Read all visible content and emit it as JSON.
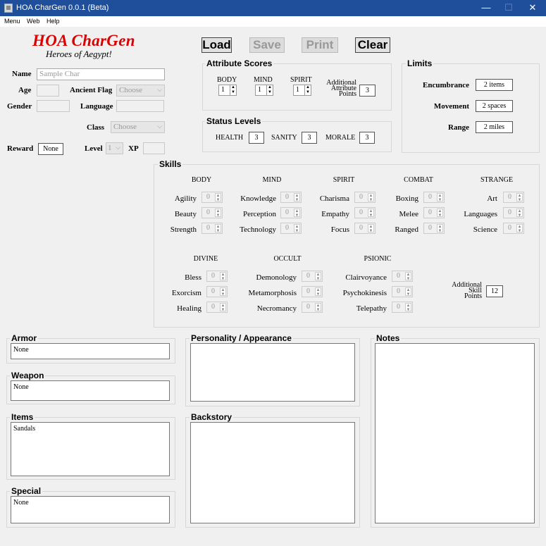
{
  "window": {
    "title": "HOA CharGen 0.0.1 (Beta)",
    "min": "—",
    "max": "☐",
    "close": "✕"
  },
  "menu": [
    "Menu",
    "Web",
    "Help"
  ],
  "logo": {
    "title": "HOA CharGen",
    "subtitle": "Heroes of Aegypt!"
  },
  "toolbar": {
    "load": "Load",
    "save": "Save",
    "print": "Print",
    "clear": "Clear"
  },
  "identity": {
    "name_label": "Name",
    "name_placeholder": "Sample Char",
    "age_label": "Age",
    "ancient_label": "Ancient Flag",
    "ancient_value": "Choose",
    "gender_label": "Gender",
    "language_label": "Language",
    "class_label": "Class",
    "class_value": "Choose",
    "reward_label": "Reward",
    "reward_value": "None",
    "level_label": "Level",
    "level_value": "1",
    "xp_label": "XP"
  },
  "attributes": {
    "title": "Attribute Scores",
    "body_label": "BODY",
    "body_value": "1",
    "mind_label": "MIND",
    "mind_value": "1",
    "spirit_label": "SPIRIT",
    "spirit_value": "1",
    "additional_l1": "Additional",
    "additional_l2": "Attribute",
    "additional_l3": "Points",
    "additional_value": "3"
  },
  "status": {
    "title": "Status Levels",
    "health_label": "HEALTH",
    "health_value": "3",
    "sanity_label": "SANITY",
    "sanity_value": "3",
    "morale_label": "MORALE",
    "morale_value": "3"
  },
  "limits": {
    "title": "Limits",
    "enc_label": "Encumbrance",
    "enc_value": "2 items",
    "mov_label": "Movement",
    "mov_value": "2 spaces",
    "range_label": "Range",
    "range_value": "2 miles"
  },
  "skills": {
    "title": "Skills",
    "body": {
      "title": "BODY",
      "items": [
        {
          "name": "Agility",
          "value": "0"
        },
        {
          "name": "Beauty",
          "value": "0"
        },
        {
          "name": "Strength",
          "value": "0"
        }
      ]
    },
    "mind": {
      "title": "MIND",
      "items": [
        {
          "name": "Knowledge",
          "value": "0"
        },
        {
          "name": "Perception",
          "value": "0"
        },
        {
          "name": "Technology",
          "value": "0"
        }
      ]
    },
    "spirit": {
      "title": "SPIRIT",
      "items": [
        {
          "name": "Charisma",
          "value": "0"
        },
        {
          "name": "Empathy",
          "value": "0"
        },
        {
          "name": "Focus",
          "value": "0"
        }
      ]
    },
    "combat": {
      "title": "COMBAT",
      "items": [
        {
          "name": "Boxing",
          "value": "0"
        },
        {
          "name": "Melee",
          "value": "0"
        },
        {
          "name": "Ranged",
          "value": "0"
        }
      ]
    },
    "strange": {
      "title": "STRANGE",
      "items": [
        {
          "name": "Art",
          "value": "0"
        },
        {
          "name": "Languages",
          "value": "0"
        },
        {
          "name": "Science",
          "value": "0"
        }
      ]
    },
    "divine": {
      "title": "DIVINE",
      "items": [
        {
          "name": "Bless",
          "value": "0"
        },
        {
          "name": "Exorcism",
          "value": "0"
        },
        {
          "name": "Healing",
          "value": "0"
        }
      ]
    },
    "occult": {
      "title": "OCCULT",
      "items": [
        {
          "name": "Demonology",
          "value": "0"
        },
        {
          "name": "Metamorphosis",
          "value": "0"
        },
        {
          "name": "Necromancy",
          "value": "0"
        }
      ]
    },
    "psionic": {
      "title": "PSIONIC",
      "items": [
        {
          "name": "Clairvoyance",
          "value": "0"
        },
        {
          "name": "Psychokinesis",
          "value": "0"
        },
        {
          "name": "Telepathy",
          "value": "0"
        }
      ]
    },
    "additional_l1": "Additional",
    "additional_l2": "Skill",
    "additional_l3": "Points",
    "additional_value": "12"
  },
  "panels": {
    "armor_title": "Armor",
    "armor_value": "None",
    "weapon_title": "Weapon",
    "weapon_value": "None",
    "items_title": "Items",
    "items_value": "Sandals",
    "special_title": "Special",
    "special_value": "None",
    "personality_title": "Personality / Appearance",
    "personality_value": "",
    "backstory_title": "Backstory",
    "backstory_value": "",
    "notes_title": "Notes",
    "notes_value": ""
  },
  "colors": {
    "titlebar": "#1f4f9a",
    "logo": "#dd0000"
  }
}
